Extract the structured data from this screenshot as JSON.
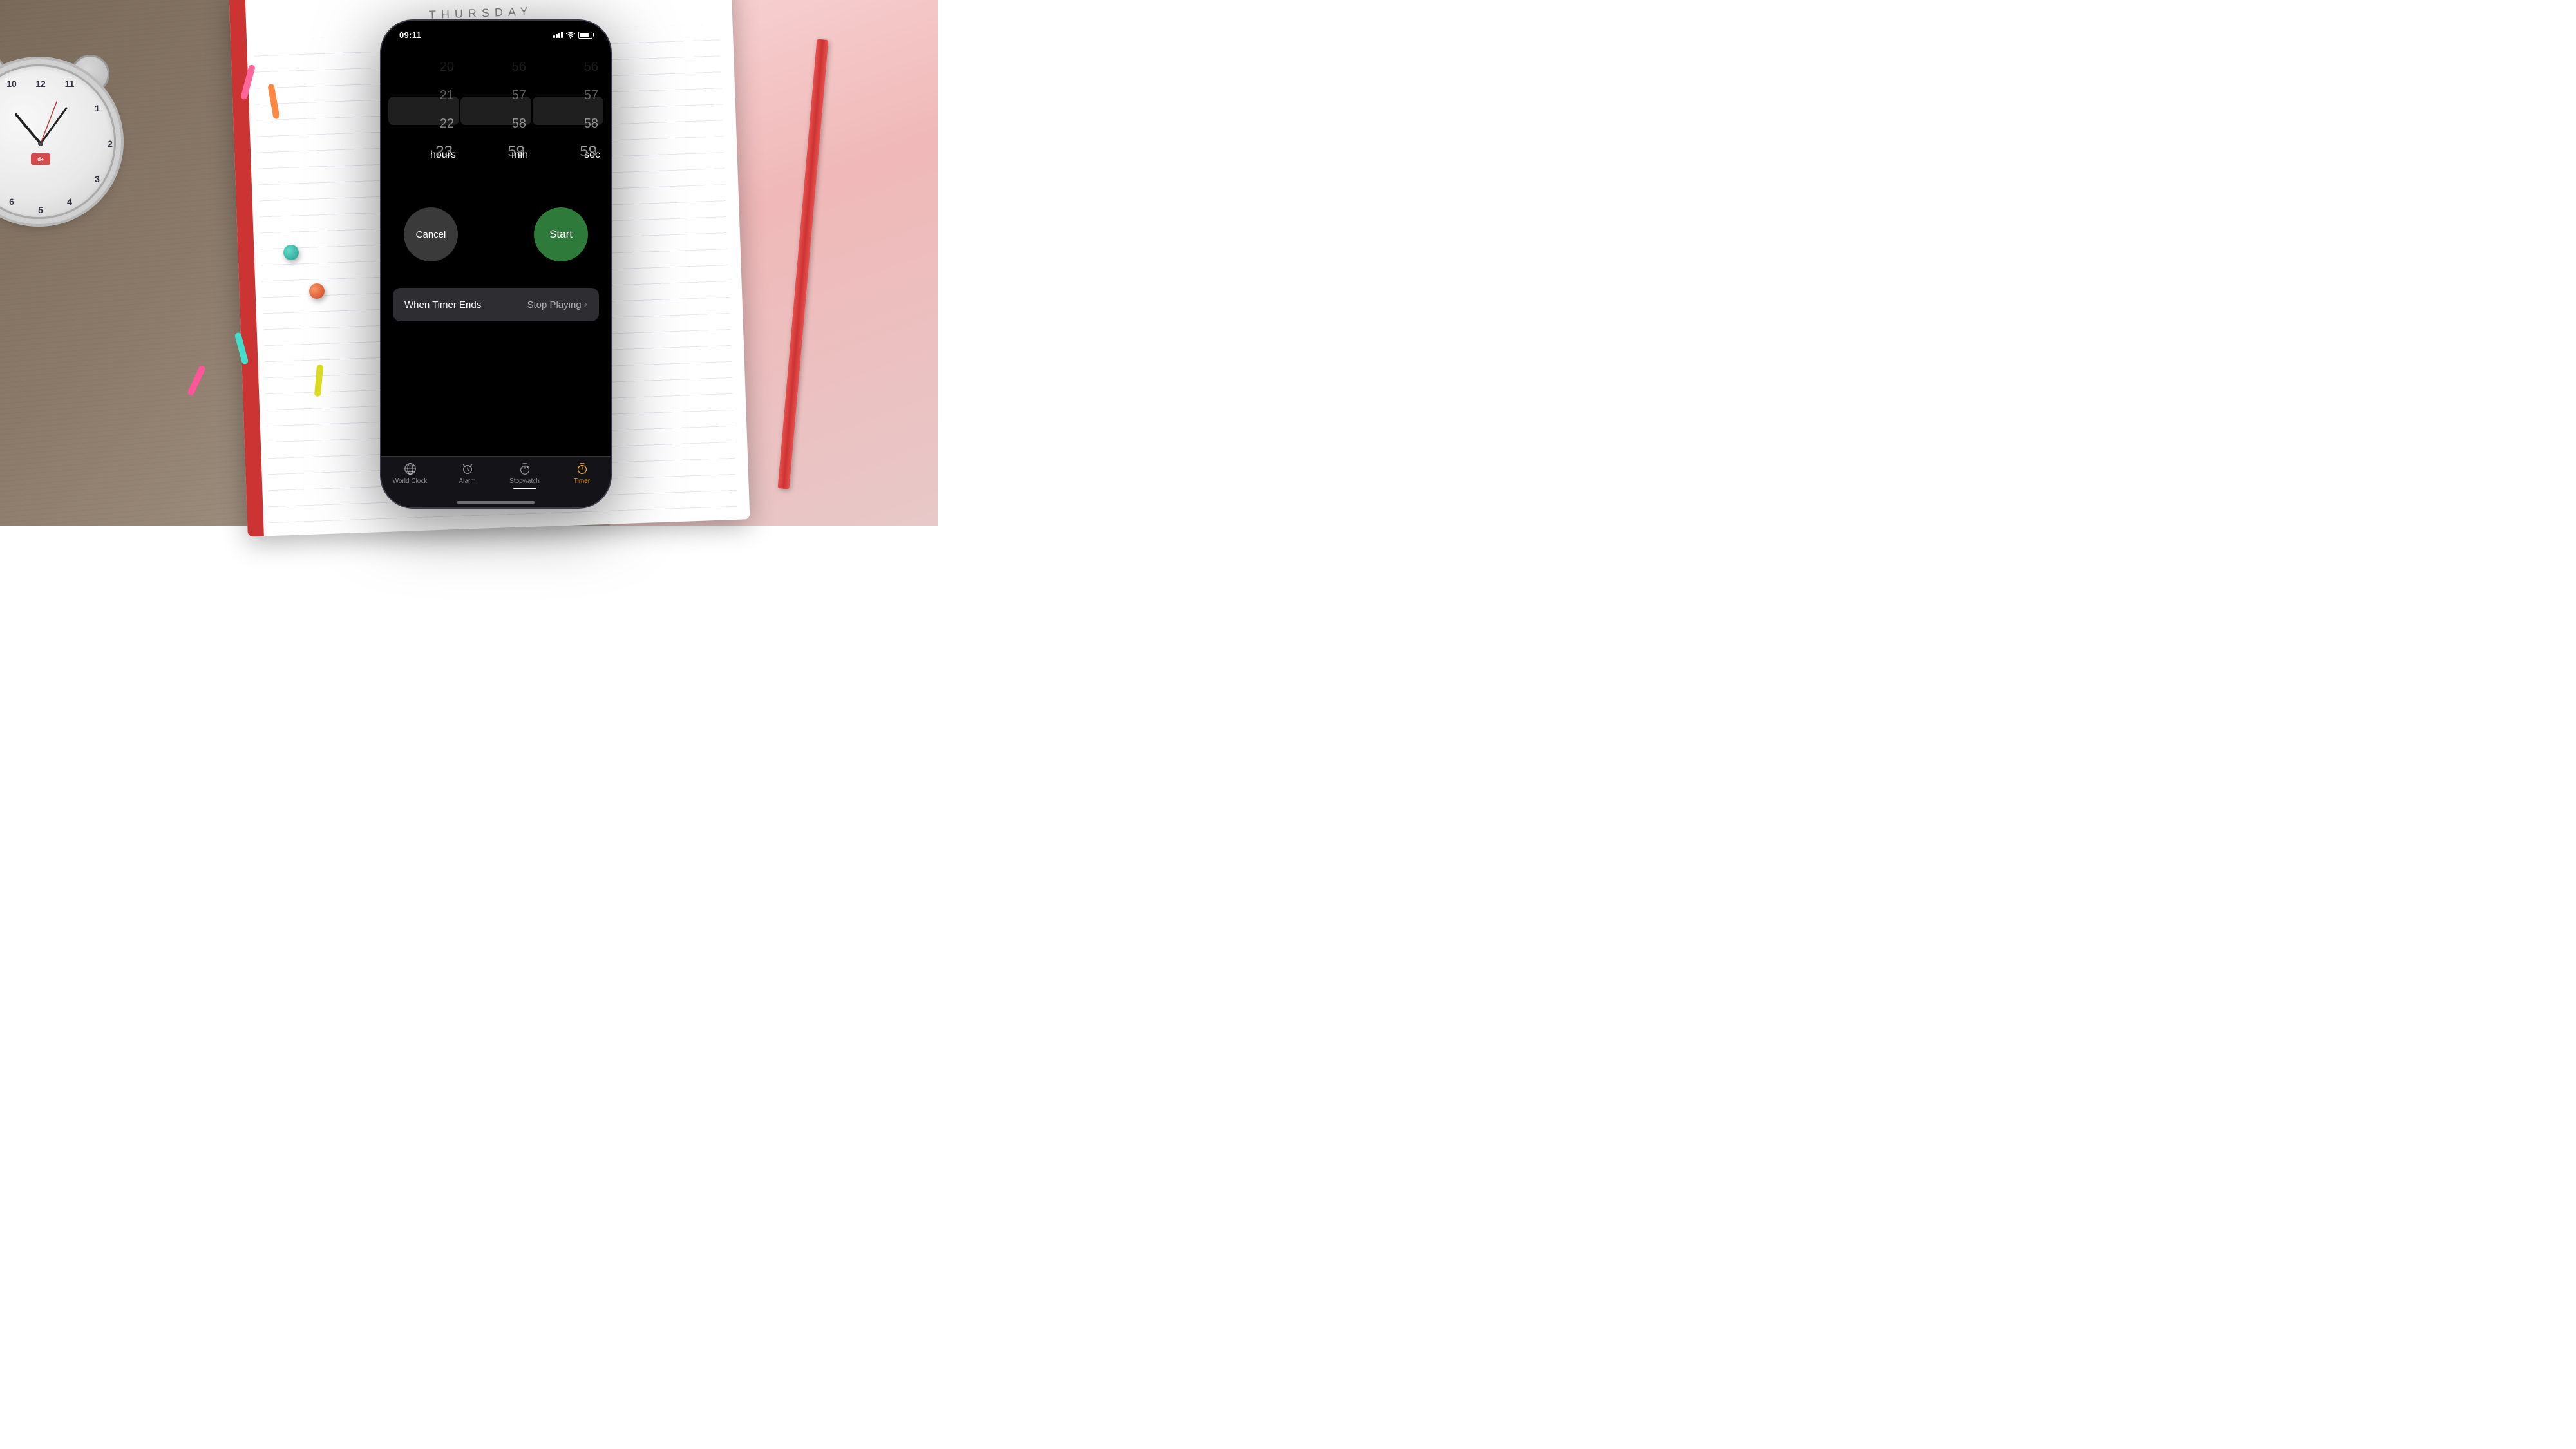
{
  "background": {
    "label": "THURSDAY"
  },
  "status_bar": {
    "time": "09:11",
    "signal_bars": [
      4,
      6,
      8,
      10,
      12
    ],
    "wifi": "wifi",
    "battery_percent": 85
  },
  "picker": {
    "hours": {
      "values_above": [
        "20",
        "21",
        "22"
      ],
      "selected": "23",
      "label": "hours"
    },
    "minutes": {
      "values_above": [
        "56",
        "57",
        "58"
      ],
      "selected": "59",
      "label": "min"
    },
    "seconds": {
      "values_above": [
        "56",
        "57",
        "58"
      ],
      "selected": "59",
      "label": "sec"
    }
  },
  "buttons": {
    "cancel": "Cancel",
    "start": "Start"
  },
  "timer_ends": {
    "label": "When Timer Ends",
    "value": "Stop Playing",
    "chevron": "›"
  },
  "tab_bar": {
    "items": [
      {
        "id": "world-clock",
        "label": "World Clock",
        "icon": "globe",
        "active": false
      },
      {
        "id": "alarm",
        "label": "Alarm",
        "icon": "alarm",
        "active": false
      },
      {
        "id": "stopwatch",
        "label": "Stopwatch",
        "icon": "stopwatch",
        "active": false
      },
      {
        "id": "timer",
        "label": "Timer",
        "icon": "timer",
        "active": true
      }
    ]
  }
}
